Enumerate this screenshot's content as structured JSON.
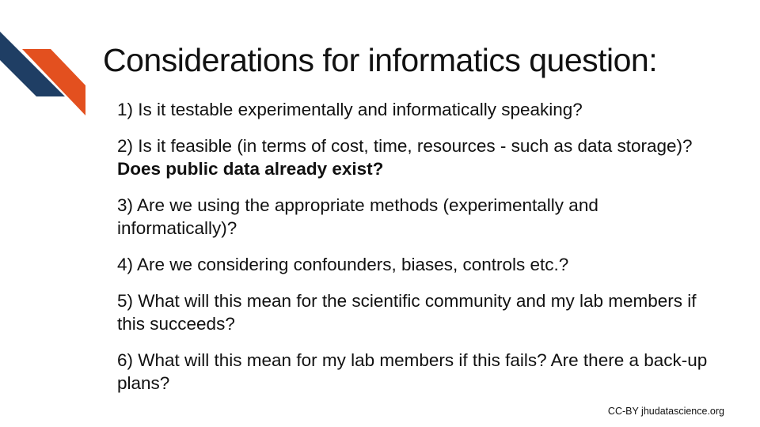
{
  "slide": {
    "title": "Considerations for informatics question:",
    "items": [
      {
        "text": "1) Is it testable experimentally and informatically speaking?"
      },
      {
        "text": "2) Is it feasible (in terms of cost, time, resources - such as data storage)? ",
        "bold": "Does public data already exist?"
      },
      {
        "text": "3) Are we using the appropriate methods (experimentally and informatically)?"
      },
      {
        "text": "4) Are we considering confounders, biases, controls etc.?"
      },
      {
        "text": "5) What will this mean for the scientific community and my lab members if this succeeds?"
      },
      {
        "text": "6) What will this mean for my lab members if this fails? Are there a back-up plans?"
      }
    ],
    "footer": "CC-BY jhudatascience.org"
  },
  "colors": {
    "logo_navy": "#1f3e64",
    "logo_orange": "#e3501f"
  },
  "icons": {
    "logo": "stripes-logo-icon"
  }
}
